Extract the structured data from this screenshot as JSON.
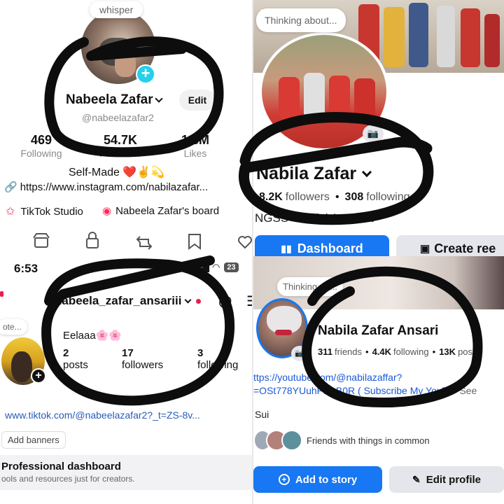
{
  "p1_tiktok": {
    "note_text": "whisper",
    "display_name": "Nabeela Zafar",
    "edit_label": "Edit",
    "username": "@nabeelazafar2",
    "stats": [
      {
        "value": "469",
        "label": "Following"
      },
      {
        "value": "54.7K",
        "label": "Followers"
      },
      {
        "value": "1.6M",
        "label": "Likes"
      }
    ],
    "bio": "Self-Made ❤️✌️💫",
    "link": "https://www.instagram.com/nabilazafar...",
    "studio_label": "TikTok Studio",
    "board_label": "Nabeela Zafar's board",
    "icons": [
      "shop-icon",
      "lock-icon",
      "repost-icon",
      "bookmark-icon",
      "heart-icon"
    ]
  },
  "p2_facebook": {
    "thinking_text": "Thinking about...",
    "name": "Nabila Zafar",
    "followers_count": "8.2K",
    "followers_label": "followers",
    "following_count": "308",
    "following_label": "following",
    "dot": "•",
    "bio": "NGSS Official Account",
    "dashboard_label": "Dashboard",
    "create_label": "Create ree"
  },
  "p3_instagram": {
    "time": "6:53",
    "battery": "23",
    "username": "nabeela_zafar_ansariii",
    "note_text": "ote...",
    "bio": "Eelaaa🌸🌸",
    "stats": [
      {
        "value": "2",
        "label": "posts"
      },
      {
        "value": "17",
        "label": "followers"
      },
      {
        "value": "3",
        "label": "following"
      }
    ],
    "link": "www.tiktok.com/@nabeelazafar2?_t=ZS-8v...",
    "banners_label": "Add banners",
    "dashboard_title": "Professional dashboard",
    "dashboard_sub": "ools and resources just for creators."
  },
  "p4_facebook": {
    "thinking_text": "Thinking ab...",
    "name": "Nabila Zafar Ansari",
    "friends_count": "311",
    "friends_label": "friends",
    "following_count": "4.4K",
    "following_label": "following",
    "posts_count": "13K",
    "posts_label": "posts",
    "link_line1": "ttps://youtube.com/@nabilazaffar?",
    "link_line2": "=OSt778YUuhPNbB0R ( Subscribe My YouT...",
    "see_more": "See",
    "bio": "Sui",
    "friends_common": "Friends with things in common",
    "add_story_label": "Add to story",
    "edit_profile_label": "Edit profile"
  },
  "colors": {
    "tiktok_cyan": "#25d0ec",
    "tiktok_pink": "#fe2c55",
    "fb_blue": "#1877f2",
    "link_blue": "#2a5bb8",
    "ink": "#0d0d0d"
  }
}
